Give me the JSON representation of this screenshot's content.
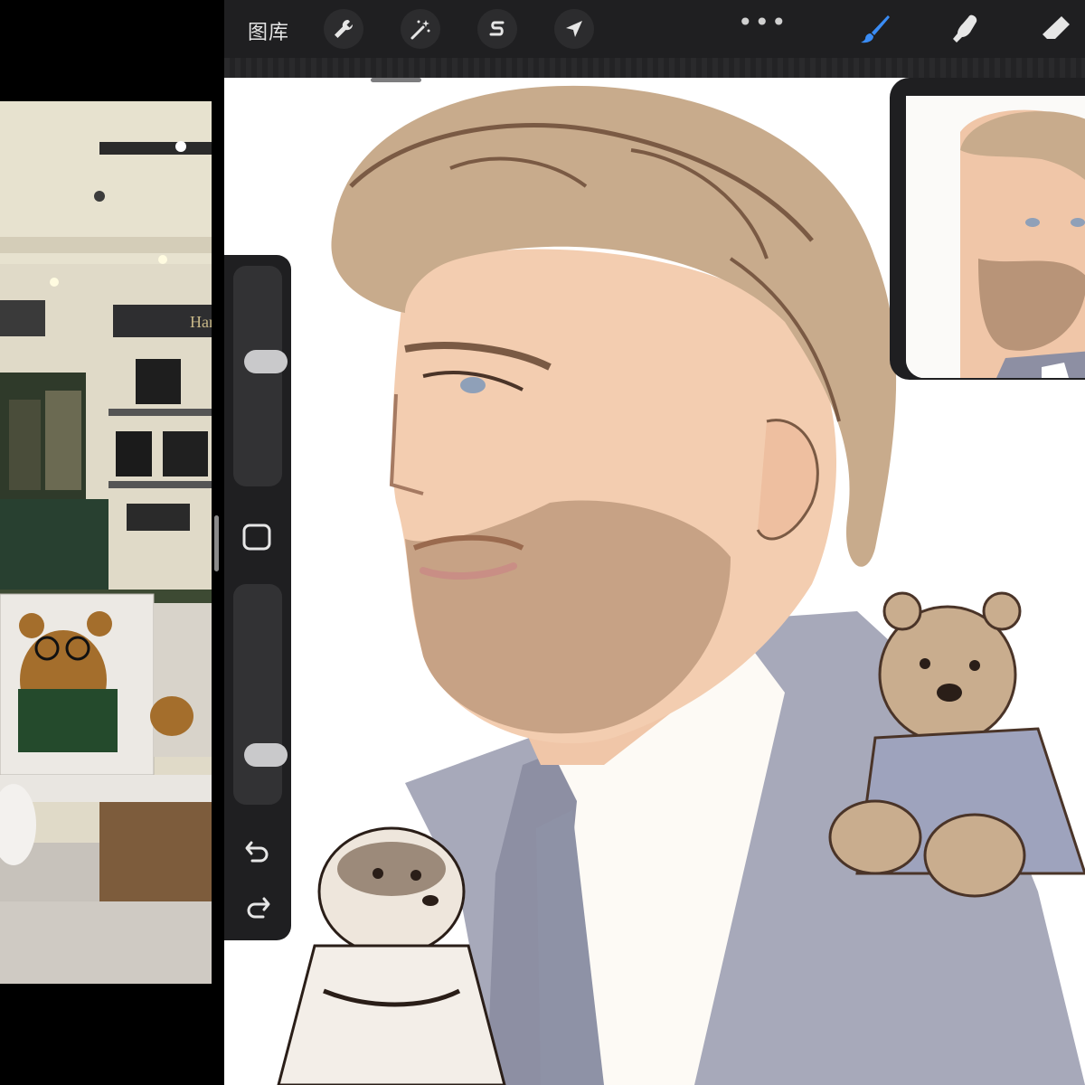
{
  "toolbar": {
    "gallery_label": "图库",
    "more_label": "•••"
  },
  "icons": {
    "actions": "wrench-icon",
    "adjustments": "magic-wand-icon",
    "selection": "selection-s-icon",
    "transform": "arrow-cursor-icon",
    "brush": "brush-icon",
    "smudge": "smudge-finger-icon",
    "eraser": "eraser-icon",
    "undo": "undo-arrow-icon",
    "redo": "redo-arrow-icon"
  },
  "colors": {
    "brush_active": "#3a8cf5",
    "toolbar_bg": "#1f1f21"
  },
  "sidebar": {
    "brush_size_level": 0.58,
    "opacity_level": 0.17
  }
}
